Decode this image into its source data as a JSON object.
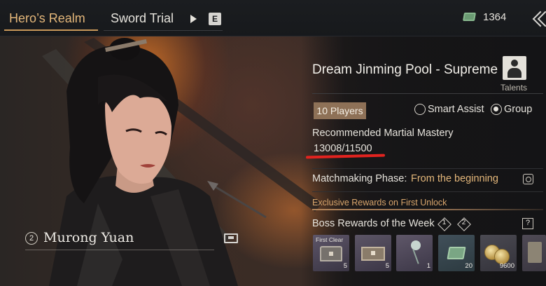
{
  "tabs": {
    "active_label": "Hero’s Realm",
    "secondary_label": "Sword Trial",
    "key_hint": "E"
  },
  "currency": {
    "icon": "banknote-icon",
    "value": "1364"
  },
  "character": {
    "level": "2",
    "name": "Murong Yuan"
  },
  "dungeon": {
    "title": "Dream Jinming Pool - Supreme",
    "talents_label": "Talents",
    "players_label": "10 Players",
    "mode_options": [
      "Smart Assist",
      "Group"
    ],
    "selected_mode": "Group",
    "mastery_label": "Recommended Martial Mastery",
    "mastery_value": "13008/11500",
    "match_label": "Matchmaking Phase:",
    "match_value": "From the beginning",
    "exclusive_label": "Exclusive Rewards on First Unlock",
    "boss_label": "Boss Rewards of the Week",
    "boss_markers": [
      "1",
      "2"
    ],
    "help_label": "?"
  },
  "rewards": [
    {
      "tag": "First Clear",
      "qty": "5",
      "icon": "chest-icon"
    },
    {
      "tag": "",
      "qty": "5",
      "icon": "box-icon"
    },
    {
      "tag": "",
      "qty": "1",
      "icon": "flower-icon"
    },
    {
      "tag": "",
      "qty": "20",
      "icon": "banknote-icon"
    },
    {
      "tag": "",
      "qty": "9600",
      "icon": "coins-icon"
    },
    {
      "tag": "",
      "qty": "",
      "icon": "scroll-icon"
    }
  ],
  "colors": {
    "accent_gold": "#e4b77a",
    "players_badge": "#8e7157",
    "annotation_red": "#e2231f"
  }
}
